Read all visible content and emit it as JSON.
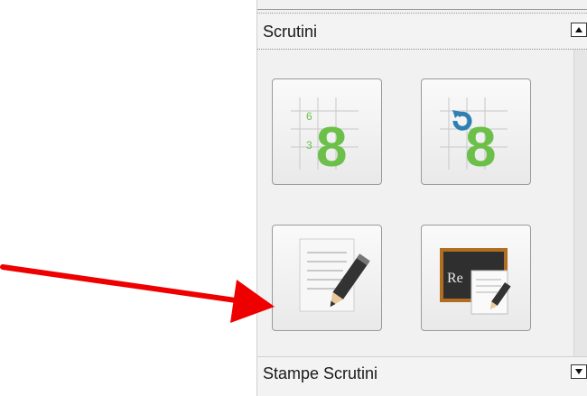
{
  "sections": [
    {
      "title": "Scrutini",
      "state": "expanded",
      "toggle_icon": "collapse-arrow-up-icon"
    },
    {
      "title": "Stampe Scrutini",
      "state": "collapsed",
      "toggle_icon": "expand-arrow-down-icon"
    }
  ],
  "tiles": [
    {
      "icon": "grade-grid-8-icon",
      "grid_numbers": [
        "6",
        "3"
      ],
      "big_number": "8"
    },
    {
      "icon": "refresh-grade-8-icon",
      "big_number": "8"
    },
    {
      "icon": "document-pencil-icon"
    },
    {
      "icon": "blackboard-document-icon",
      "blackboard_text": "Re"
    }
  ],
  "colors": {
    "accent_green": "#6cc04a",
    "refresh_blue": "#2f7fb3",
    "arrow_red": "#ee0000"
  }
}
